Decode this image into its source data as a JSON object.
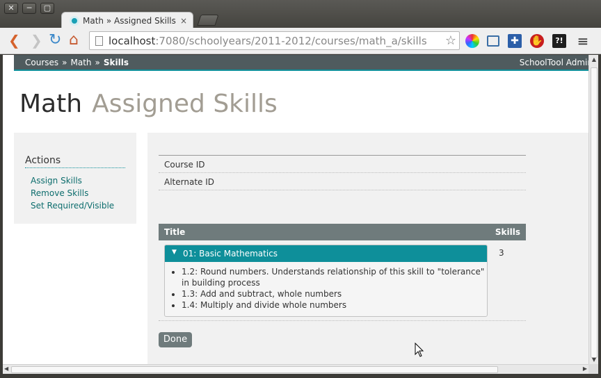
{
  "window": {
    "close_glyph": "✕",
    "minimize_glyph": "─",
    "maximize_glyph": "▢"
  },
  "tab": {
    "title": "Math » Assigned Skills",
    "close_glyph": "×"
  },
  "toolbar": {
    "back_glyph": "❮",
    "forward_glyph": "❯",
    "reload_glyph": "↻",
    "home_glyph": "⌂",
    "url_host": "localhost",
    "url_rest": ":7080/schoolyears/2011-2012/courses/math_a/skills",
    "star_glyph": "☆",
    "ext_block_glyph": "✋",
    "ext_help_glyph": "?!",
    "menu_glyph": "≡"
  },
  "breadcrumb": {
    "items": [
      "Courses",
      "Math",
      "Skills"
    ],
    "separator": "»",
    "user": "SchoolTool Admin"
  },
  "page": {
    "title": "Math",
    "subtitle": "Assigned Skills"
  },
  "sidebar": {
    "heading": "Actions",
    "links": [
      "Assign Skills",
      "Remove Skills",
      "Set Required/Visible"
    ]
  },
  "details": {
    "rows": [
      "Course ID",
      "Alternate ID"
    ]
  },
  "skills_table": {
    "headers": {
      "title": "Title",
      "skills": "Skills"
    },
    "group": {
      "toggle_glyph": "▼",
      "title": "01: Basic Mathematics",
      "count": "3",
      "items": [
        "1.2: Round numbers. Understands relationship of this skill to \"tolerance\" in building process",
        "1.3: Add and subtract, whole numbers",
        "1.4: Multiply and divide whole numbers"
      ]
    }
  },
  "done_button": {
    "label": "Done"
  },
  "colors": {
    "accent": "#0e8f9a",
    "header_gray": "#6f7b7c",
    "crumbbar": "#4f5b5e",
    "link": "#0d6d6d"
  }
}
